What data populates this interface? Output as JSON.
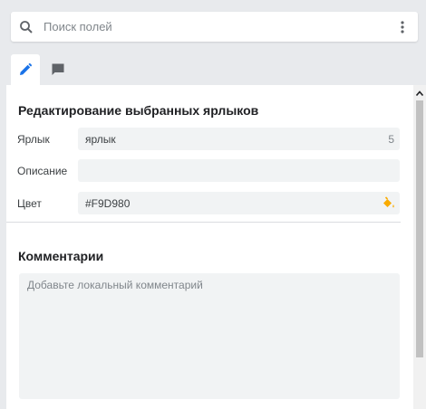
{
  "search": {
    "placeholder": "Поиск полей"
  },
  "tabs": [
    {
      "icon": "pencil-icon",
      "active": true
    },
    {
      "icon": "comment-icon",
      "active": false
    }
  ],
  "edit_section": {
    "title": "Редактирование выбранных ярлыков",
    "fields": {
      "label": {
        "name": "Ярлык",
        "value": "ярлык",
        "count": "5"
      },
      "description": {
        "name": "Описание",
        "value": ""
      },
      "color": {
        "name": "Цвет",
        "value": "#F9D980"
      }
    }
  },
  "comments_section": {
    "title": "Комментарии",
    "placeholder": "Добавьте локальный комментарий"
  },
  "colors": {
    "accent": "#1a73e8",
    "fill_icon": "#f9ab00",
    "panel_bg": "#ffffff",
    "page_bg": "#e8eaed",
    "field_bg": "#f1f3f4"
  }
}
